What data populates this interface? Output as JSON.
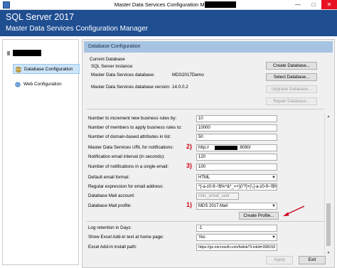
{
  "window": {
    "title": "Master Data Services Configuration Manager:"
  },
  "header": {
    "product": "SQL Server 2017",
    "subtitle": "Master Data Services Configuration Manager"
  },
  "sidebar": {
    "items": [
      {
        "label": "Database Configuration"
      },
      {
        "label": "Web Configuration"
      }
    ]
  },
  "main": {
    "section_title": "Database Configuration",
    "current_database": {
      "heading": "Current Database",
      "sql_instance_label": "SQL Server instance:",
      "mds_database_label": "Master Data Services database:",
      "mds_database_value": "MDS2017Demo",
      "version_label": "Master Data Services database version:",
      "version_value": "14.0.0.2"
    },
    "buttons": {
      "create_database": "Create Database...",
      "select_database": "Select Database...",
      "upgrade_database": "Upgrade Database...",
      "repair_database": "Repair Database...",
      "create_profile": "Create Profile...",
      "apply": "Apply",
      "exit": "Exit"
    },
    "settings": [
      {
        "label": "Number to increment new business rules by:",
        "value": "10"
      },
      {
        "label": "Number of members to apply business rules to:",
        "value": "10000"
      },
      {
        "label": "Number of domain-based attributes in list:",
        "value": "50"
      },
      {
        "label": "Master Data Services URL for notifications:",
        "value": "http://",
        "value_suffix": ":8080/"
      },
      {
        "label": "Notification email interval (in seconds):",
        "value": "120"
      },
      {
        "label": "Number of notifications in a single email:",
        "value": "100"
      },
      {
        "label": "Default email format:",
        "value": "HTML"
      },
      {
        "label": "Regular expression for email address:",
        "value": "^[-a-z0-9~!$%^&*_=+}{\\'?]+(\\.[-a-z0-9~!$%^&*_=+}{\\'?]+)*$"
      },
      {
        "label": "Database Mail account:",
        "value": "mds_email_user"
      },
      {
        "label": "Database Mail profile:",
        "value": "MDS 2017 Mail"
      },
      {
        "label": "Log retention in Days:",
        "value": "-1"
      },
      {
        "label": "Show Excel Add-in text at home page:",
        "value": "Yes"
      },
      {
        "label": "Excel Add-in install path:",
        "value": "https://go.microsoft.com/fwlink/?LinkId=398159"
      }
    ],
    "annotations": {
      "one": "1)",
      "two": "2)",
      "three": "3)"
    }
  },
  "icons": {
    "app": "app-icon",
    "server": "server-icon",
    "database": "database-icon",
    "web": "globe-icon"
  },
  "colors": {
    "header_bg": "#1f4e91",
    "section_header_bg": "#a7c3e2",
    "annotation": "#d0021b",
    "selected_nav": "#cde4f7"
  }
}
